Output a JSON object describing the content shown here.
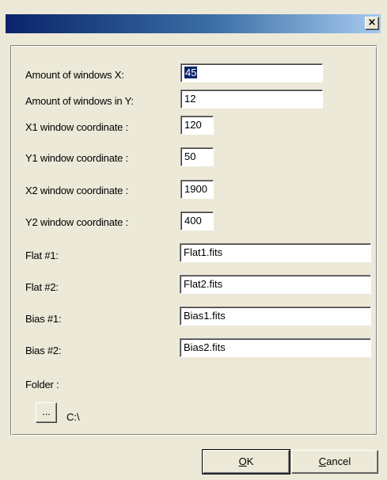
{
  "window": {
    "close_glyph": "×"
  },
  "fields": [
    {
      "label": "Amount of windows  X:",
      "value": "45",
      "selected": true
    },
    {
      "label": "Amount of windows in Y:",
      "value": "12"
    },
    {
      "label": "X1 window coordinate :",
      "value": "120"
    },
    {
      "label": "Y1 window coordinate :",
      "value": "50"
    },
    {
      "label": "X2 window coordinate :",
      "value": "1900"
    },
    {
      "label": "Y2 window coordinate :",
      "value": "400"
    },
    {
      "label": "Flat #1:",
      "value": "Flat1.fits"
    },
    {
      "label": "Flat #2:",
      "value": "Flat2.fits"
    },
    {
      "label": "Bias #1:",
      "value": "Bias1.fits"
    },
    {
      "label": "Bias #2:",
      "value": "Bias2.fits"
    }
  ],
  "folder": {
    "label": "Folder :",
    "browse_label": "...",
    "path": "C:\\"
  },
  "buttons": {
    "ok_mnemonic": "O",
    "ok_rest": "K",
    "cancel_mnemonic": "C",
    "cancel_rest": "ancel"
  }
}
